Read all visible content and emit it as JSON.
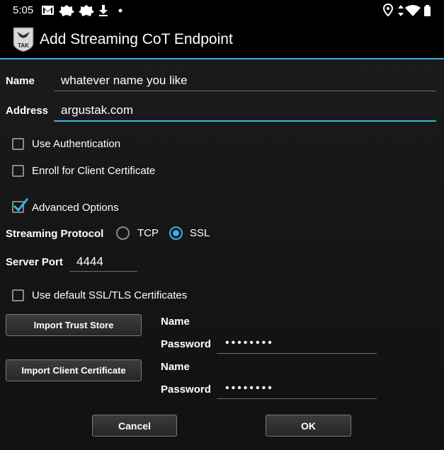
{
  "status_bar": {
    "time": "5:05",
    "left_icons": [
      "gmail-icon",
      "app-icon",
      "app-icon",
      "download-icon",
      "dot-icon"
    ],
    "right_icons": [
      "location-icon",
      "data-arrows-icon",
      "wifi-icon",
      "battery-icon"
    ]
  },
  "title_bar": {
    "title": "Add Streaming CoT Endpoint",
    "logo_text": "TAK"
  },
  "form": {
    "name_label": "Name",
    "name_value": "whatever name you like",
    "address_label": "Address",
    "address_value": "argustak.com",
    "use_auth_label": "Use Authentication",
    "use_auth_checked": false,
    "enroll_label": "Enroll for Client Certificate",
    "enroll_checked": false,
    "advanced_label": "Advanced Options",
    "advanced_checked": true,
    "protocol_label": "Streaming Protocol",
    "protocol_options": [
      "TCP",
      "SSL"
    ],
    "protocol_selected": "SSL",
    "port_label": "Server Port",
    "port_value": "4444",
    "default_certs_label": "Use default SSL/TLS Certificates",
    "default_certs_checked": false,
    "trust_store": {
      "button_label": "Import Trust Store",
      "name_label": "Name",
      "password_label": "Password",
      "password_mask": "••••••••"
    },
    "client_cert": {
      "button_label": "Import Client Certificate",
      "name_label": "Name",
      "password_label": "Password",
      "password_mask": "••••••••"
    }
  },
  "actions": {
    "cancel_label": "Cancel",
    "ok_label": "OK"
  },
  "colors": {
    "accent": "#33b5e5",
    "background": "#000000"
  }
}
